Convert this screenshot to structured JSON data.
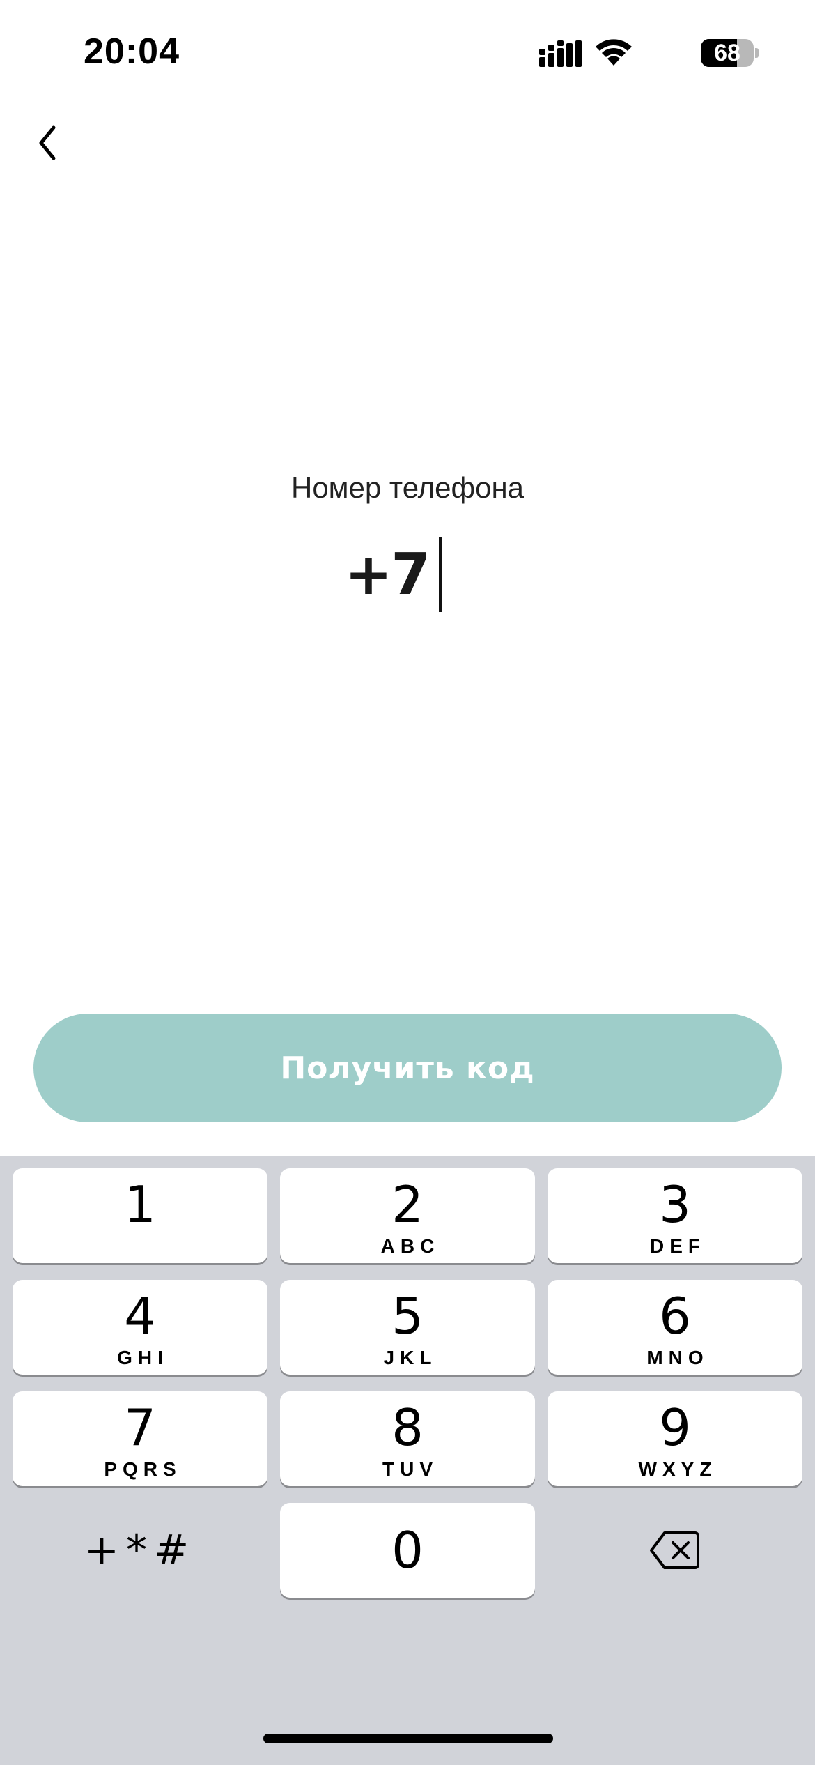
{
  "status_bar": {
    "time": "20:04",
    "battery": "68",
    "battery_level": 0.68
  },
  "nav": {
    "back_icon": "chevron-left-icon"
  },
  "phone": {
    "label": "Номер телефона",
    "value": "+7"
  },
  "cta": {
    "label": "Получить код",
    "color": "#9ecdc9"
  },
  "keypad": {
    "keys": [
      {
        "digit": "1",
        "letters": ""
      },
      {
        "digit": "2",
        "letters": "ABC"
      },
      {
        "digit": "3",
        "letters": "DEF"
      },
      {
        "digit": "4",
        "letters": "GHI"
      },
      {
        "digit": "5",
        "letters": "JKL"
      },
      {
        "digit": "6",
        "letters": "MNO"
      },
      {
        "digit": "7",
        "letters": "PQRS"
      },
      {
        "digit": "8",
        "letters": "TUV"
      },
      {
        "digit": "9",
        "letters": "WXYZ"
      },
      {
        "digit": "0",
        "letters": ""
      }
    ],
    "symbols": "+*#",
    "delete_icon": "backspace-icon",
    "background": "#d1d3d9"
  }
}
